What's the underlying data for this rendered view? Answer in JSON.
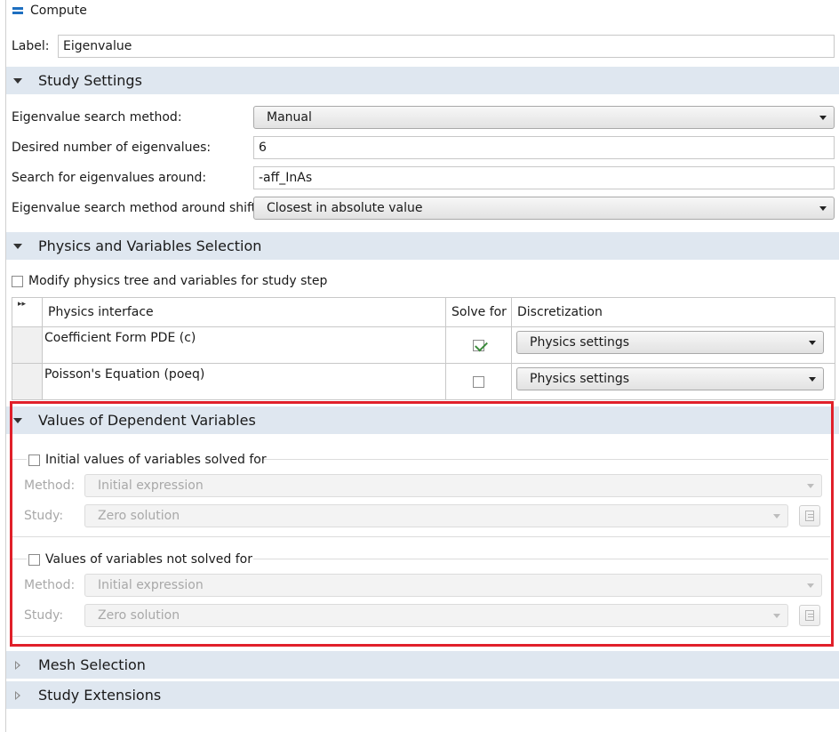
{
  "toolbar": {
    "compute_label": "Compute"
  },
  "label_row": {
    "label": "Label:",
    "value": "Eigenvalue"
  },
  "study_settings": {
    "title": "Study Settings",
    "method_label": "Eigenvalue search method:",
    "method_value": "Manual",
    "desired_label": "Desired number of eigenvalues:",
    "desired_value": "6",
    "around_label": "Search for eigenvalues around:",
    "around_value": "-aff_InAs",
    "shift_label": "Eigenvalue search method around shift:",
    "shift_value": "Closest in absolute value"
  },
  "physics": {
    "title": "Physics and Variables Selection",
    "modify_label": "Modify physics tree and variables for study step",
    "col_interface": "Physics interface",
    "col_solve": "Solve for",
    "col_disc": "Discretization",
    "rows": [
      {
        "name": "Coefficient Form PDE (c)",
        "solve": true,
        "disc": "Physics settings"
      },
      {
        "name": "Poisson's Equation (poeq)",
        "solve": false,
        "disc": "Physics settings"
      }
    ]
  },
  "dependent": {
    "title": "Values of Dependent Variables",
    "initial_label": "Initial values of variables solved for",
    "initial_method_label": "Method:",
    "initial_method_value": "Initial expression",
    "initial_study_label": "Study:",
    "initial_study_value": "Zero solution",
    "notsolved_label": "Values of variables not solved for",
    "notsolved_method_label": "Method:",
    "notsolved_method_value": "Initial expression",
    "notsolved_study_label": "Study:",
    "notsolved_study_value": "Zero solution"
  },
  "mesh": {
    "title": "Mesh Selection"
  },
  "extensions": {
    "title": "Study Extensions"
  },
  "colors": {
    "accent": "#1e6fc0",
    "section_bg": "#dfe7f0",
    "highlight": "#e0202a",
    "check": "#3a8a3a"
  }
}
